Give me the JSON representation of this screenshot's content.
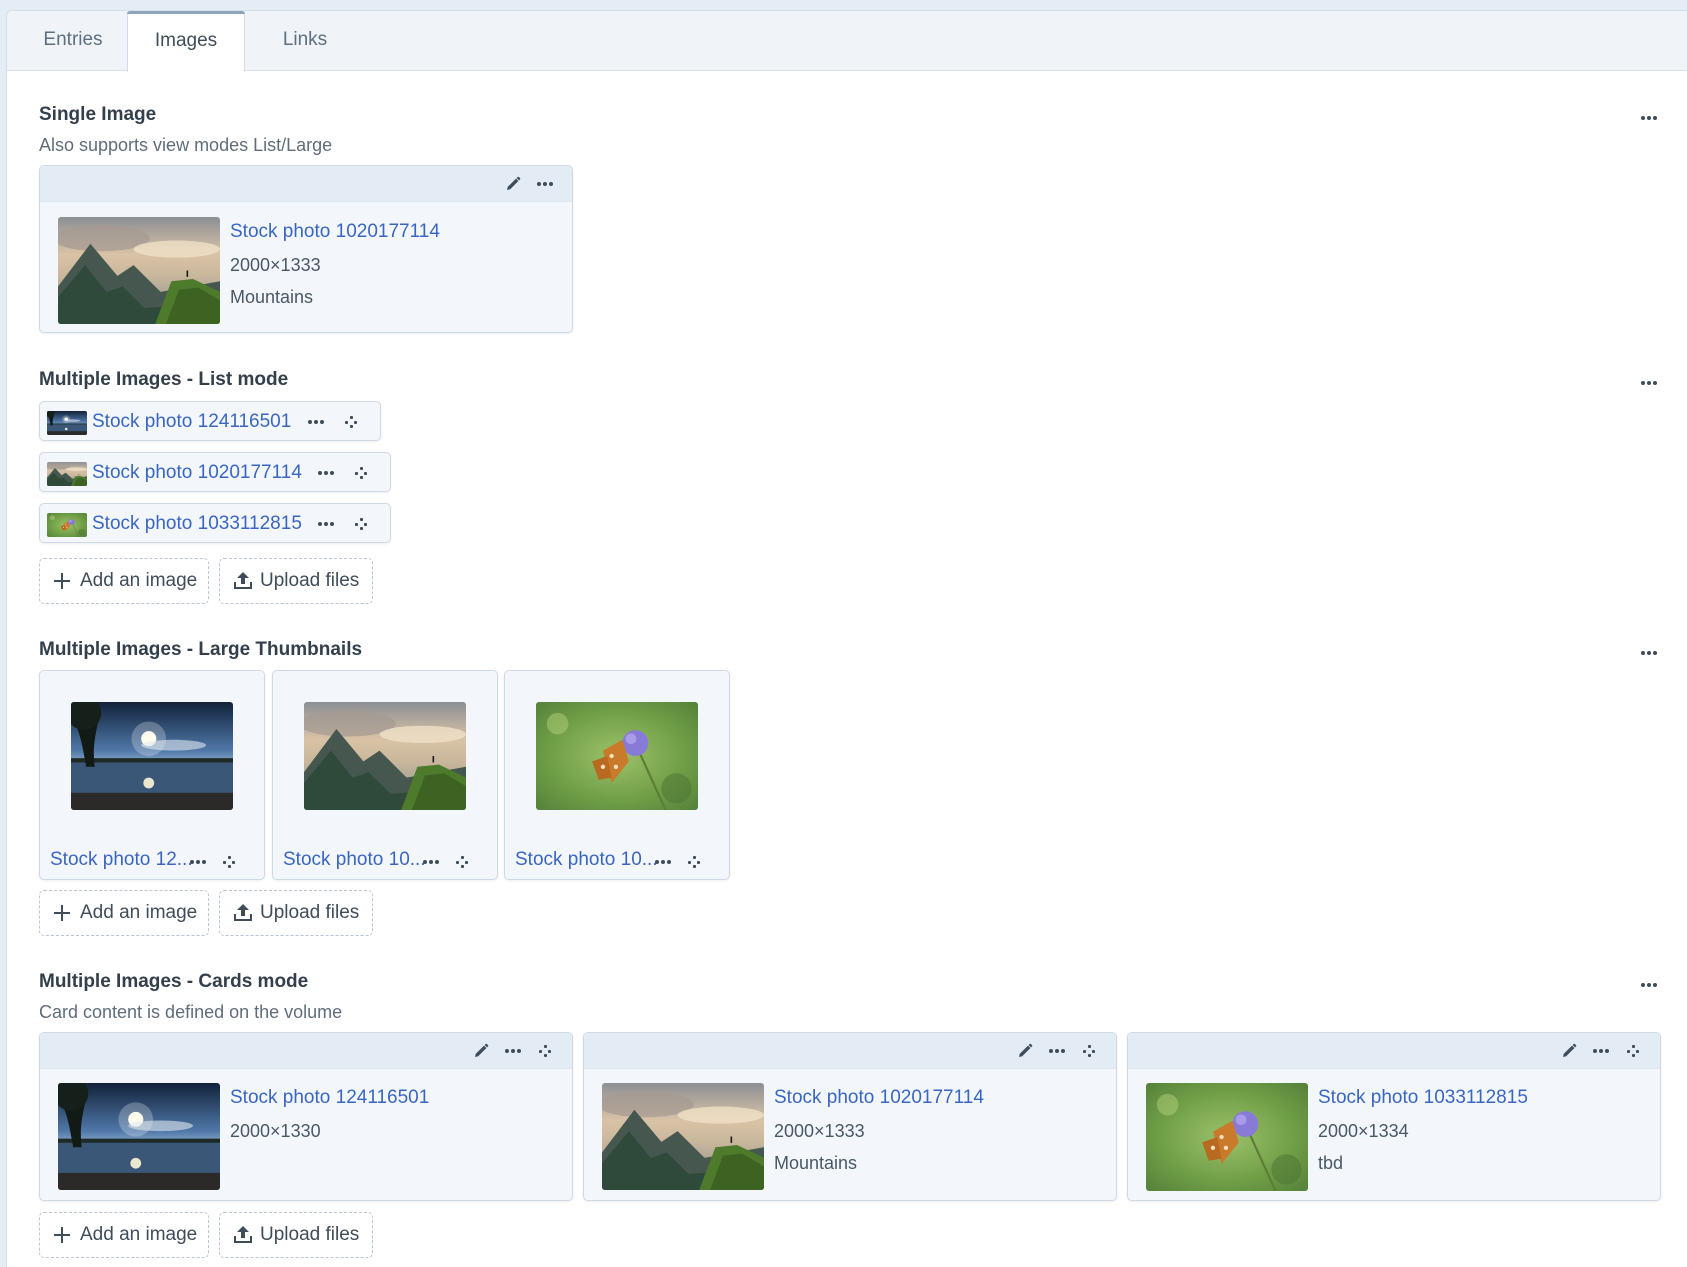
{
  "tabs": [
    {
      "label": "Entries"
    },
    {
      "label": "Images"
    },
    {
      "label": "Links"
    }
  ],
  "single": {
    "title": "Single Image",
    "instructions": "Also supports view modes List/Large",
    "asset": {
      "title": "Stock photo 1020177114",
      "dims": "2000×1333",
      "alt": "Mountains"
    }
  },
  "list_mode": {
    "title": "Multiple Images - List mode",
    "items": [
      {
        "label": "Stock photo 124116501"
      },
      {
        "label": "Stock photo 1020177114"
      },
      {
        "label": "Stock photo 1033112815"
      }
    ],
    "add_label": "Add an image",
    "upload_label": "Upload files"
  },
  "large_thumbs": {
    "title": "Multiple Images - Large Thumbnails",
    "items": [
      {
        "label": "Stock photo 12..."
      },
      {
        "label": "Stock photo 10..."
      },
      {
        "label": "Stock photo 10..."
      }
    ],
    "add_label": "Add an image",
    "upload_label": "Upload files"
  },
  "cards_mode": {
    "title": "Multiple Images - Cards mode",
    "instructions": "Card content is defined on the volume",
    "cards": [
      {
        "title": "Stock photo 124116501",
        "dims": "2000×1330",
        "alt": ""
      },
      {
        "title": "Stock photo 1020177114",
        "dims": "2000×1333",
        "alt": "Mountains"
      },
      {
        "title": "Stock photo 1033112815",
        "dims": "2000×1334",
        "alt": "tbd"
      }
    ],
    "add_label": "Add an image",
    "upload_label": "Upload files"
  },
  "icons": {
    "edit": "pencil-icon",
    "actions": "ellipsis-icon",
    "move": "move-icon",
    "add": "plus-icon",
    "upload": "upload-icon"
  },
  "colors": {
    "link": "#3a66c3",
    "card_bg": "#f3f7fc",
    "card_header": "#e3ebf5",
    "tabbar": "#f0f4f9"
  }
}
